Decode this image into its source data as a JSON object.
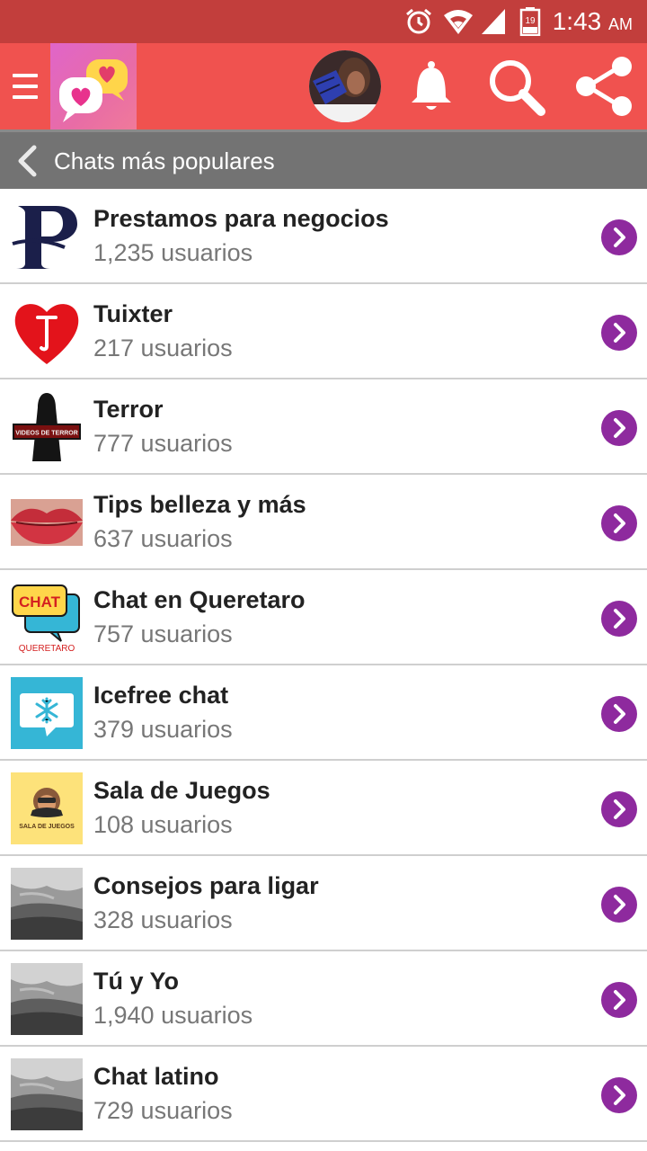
{
  "status_bar": {
    "time": "1:43",
    "ampm": "AM",
    "battery_level": "19",
    "icons": [
      "alarm-icon",
      "wifi-icon",
      "signal-icon",
      "battery-icon"
    ]
  },
  "toolbar": {
    "icons": [
      "menu-icon",
      "app-logo",
      "avatar",
      "bell-icon",
      "search-icon",
      "share-icon"
    ]
  },
  "subheader": {
    "title": "Chats más populares",
    "icon": "chevron-left-icon"
  },
  "chats": [
    {
      "name": "Prestamos para negocios",
      "users": "1,235 usuarios",
      "thumb": "letter-p"
    },
    {
      "name": "Tuixter",
      "users": "217 usuarios",
      "thumb": "heart"
    },
    {
      "name": "Terror",
      "users": "777 usuarios",
      "thumb": "terror",
      "thumb_text": "VIDEOS DE TERROR"
    },
    {
      "name": "Tips belleza y más",
      "users": "637 usuarios",
      "thumb": "lips"
    },
    {
      "name": "Chat en Queretaro",
      "users": "757 usuarios",
      "thumb": "chat-bubble",
      "thumb_text": "CHAT",
      "thumb_subtext": "QUERETARO"
    },
    {
      "name": "Icefree chat",
      "users": "379 usuarios",
      "thumb": "snowflake"
    },
    {
      "name": "Sala de Juegos",
      "users": "108 usuarios",
      "thumb": "games",
      "thumb_text": "SALA DE JUEGOS"
    },
    {
      "name": "Consejos para ligar",
      "users": "328 usuarios",
      "thumb": "clouds"
    },
    {
      "name": "Tú y Yo",
      "users": "1,940 usuarios",
      "thumb": "clouds"
    },
    {
      "name": "Chat latino",
      "users": "729 usuarios",
      "thumb": "clouds"
    }
  ],
  "colors": {
    "status_bar": "#c23e3c",
    "toolbar": "#f0524f",
    "subheader": "#737373",
    "go_button": "#8e2a9e"
  }
}
